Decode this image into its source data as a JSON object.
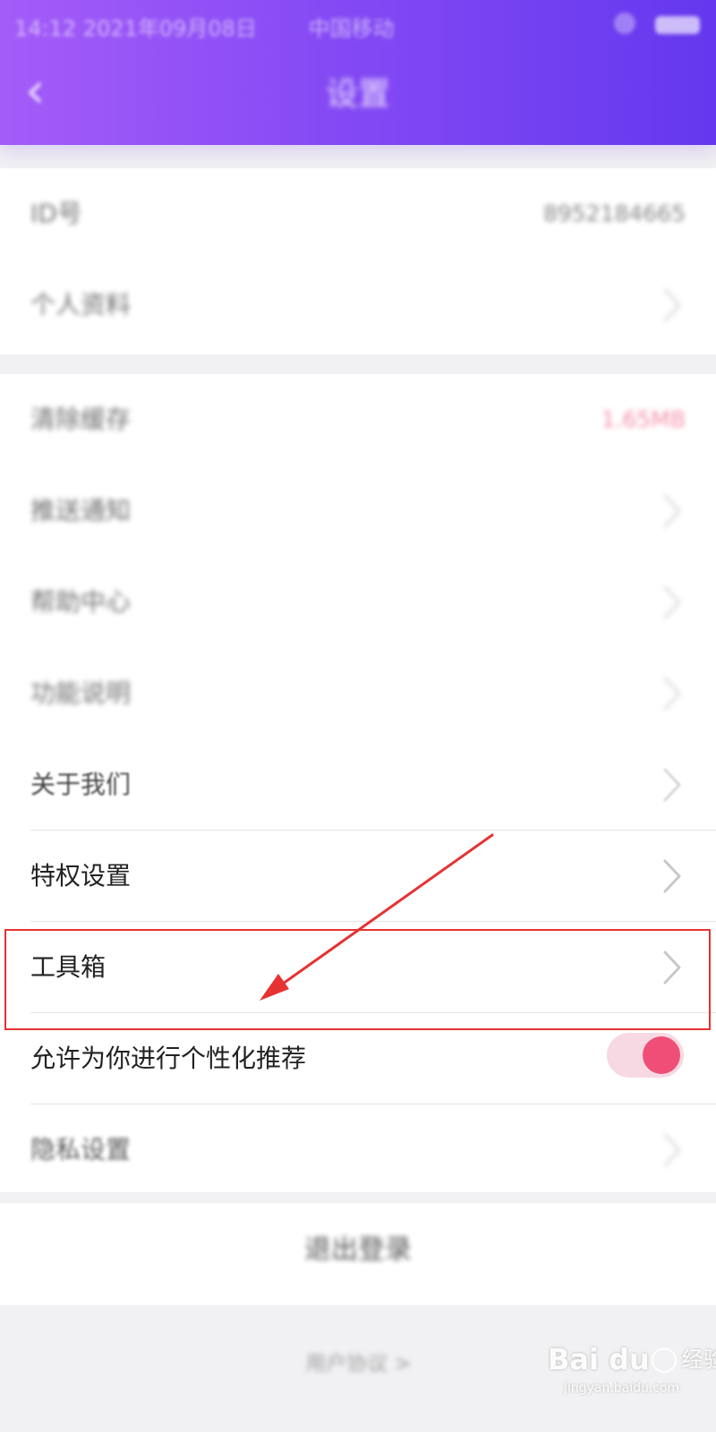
{
  "status_bar": {
    "left_text": "14:12 2021年09月08日",
    "center_text": "中国移动",
    "battery_icon": "battery-icon",
    "signal_icon": "signal-icon"
  },
  "header": {
    "back_icon": "back-arrow-icon",
    "title": "设置"
  },
  "account_section": [
    {
      "label": "ID号",
      "value": "8952184665"
    },
    {
      "label": "个人资料",
      "value": ""
    }
  ],
  "settings_section": [
    {
      "label": "清除缓存",
      "value": "1.65MB"
    },
    {
      "label": "推送通知",
      "value": ""
    },
    {
      "label": "帮助中心",
      "value": ""
    },
    {
      "label": "功能说明",
      "value": ""
    },
    {
      "label": "关于我们",
      "value": ""
    },
    {
      "label": "特权设置",
      "value": ""
    },
    {
      "label": "工具箱",
      "value": ""
    },
    {
      "label": "允许为你进行个性化推荐",
      "toggle": true
    },
    {
      "label": "隐私设置",
      "value": ""
    }
  ],
  "logout": {
    "label": "退出登录"
  },
  "footer": {
    "label": "用户协议 >"
  },
  "watermark": {
    "brand": "Bai du",
    "cn": "经验",
    "domain": "jingyan.baidu.com"
  },
  "colors": {
    "header_start": "#a45cf8",
    "header_end": "#6438ee",
    "accent_pink": "#ef4f76",
    "highlight_red": "#e63232"
  }
}
